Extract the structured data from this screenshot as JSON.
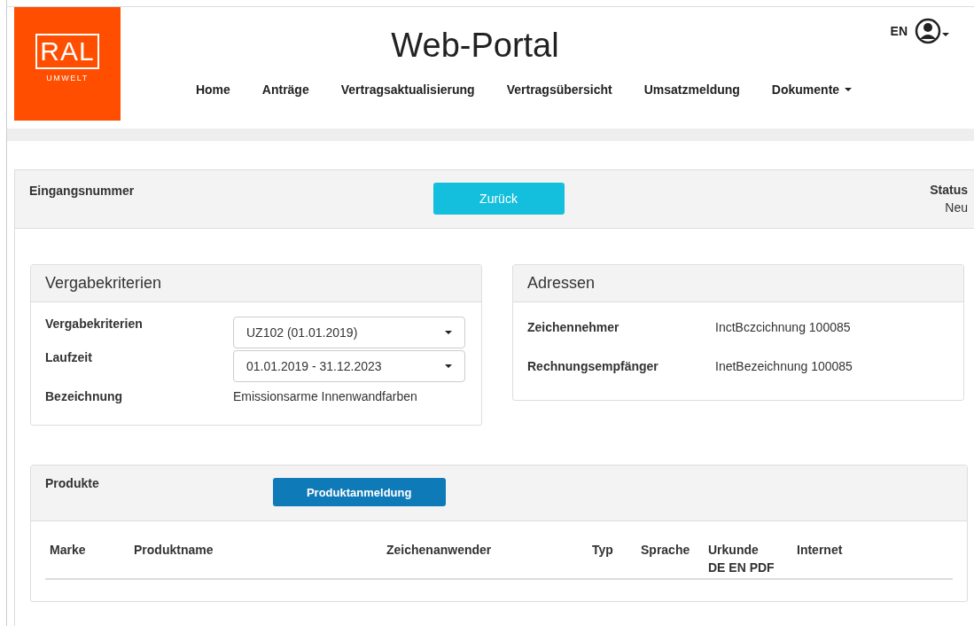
{
  "logo": {
    "mark": "RAL",
    "subtitle": "UMWELT"
  },
  "header": {
    "title": "Web-Portal",
    "language": "EN"
  },
  "nav": [
    {
      "label": "Home",
      "kind": "link"
    },
    {
      "label": "Anträge",
      "kind": "link"
    },
    {
      "label": "Vertragsaktualisierung",
      "kind": "link"
    },
    {
      "label": "Vertragsübersicht",
      "kind": "link"
    },
    {
      "label": "Umsatzmeldung",
      "kind": "link"
    },
    {
      "label": "Dokumente",
      "kind": "dropdown"
    }
  ],
  "summary": {
    "label": "Eingangsnummer",
    "back_button": "Zurück",
    "status_label": "Status",
    "status_value": "Neu"
  },
  "criteria_panel": {
    "title": "Vergabekriterien",
    "rows": [
      {
        "label": "Vergabekriterien",
        "kind": "select",
        "value": "UZ102 (01.01.2019)"
      },
      {
        "label": "Laufzeit",
        "kind": "select",
        "value": "01.01.2019 - 31.12.2023"
      },
      {
        "label": "Bezeichnung",
        "kind": "text",
        "value": "Emissionsarme Innenwandfarben"
      }
    ]
  },
  "address_panel": {
    "title": "Adressen",
    "rows": [
      {
        "label": "Zeichennehmer",
        "value": "InctBczcichnung 100085"
      },
      {
        "label": "Rechnungsempfänger",
        "value": "InetBezeichnung 100085"
      }
    ]
  },
  "products": {
    "title": "Produkte",
    "button": "Produktanmeldung",
    "columns": [
      {
        "label": "Marke"
      },
      {
        "label": "Produktname"
      },
      {
        "label": "Zeichenanwender"
      },
      {
        "label": "Typ"
      },
      {
        "label": "Sprache"
      },
      {
        "label": "Urkunde",
        "sublabel": "DE EN PDF"
      },
      {
        "label": "Internet"
      }
    ]
  }
}
